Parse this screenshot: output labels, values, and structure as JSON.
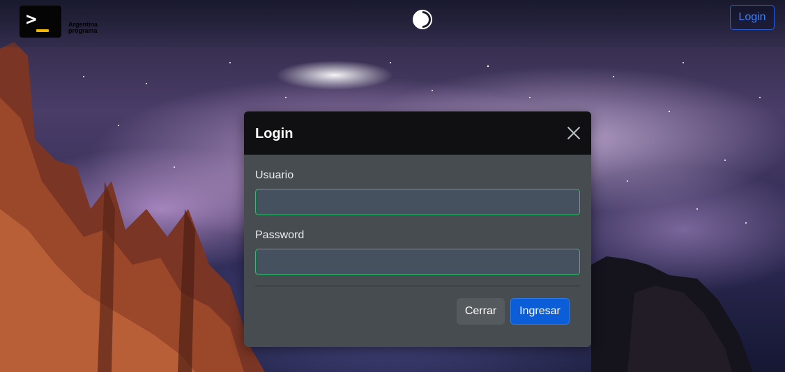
{
  "navbar": {
    "brand_line1": "Argentina",
    "brand_line2": "programa",
    "logo_icon": "terminal-prompt-icon",
    "theme_icon": "contrast-toggle-icon",
    "login_label": "Login"
  },
  "modal": {
    "title": "Login",
    "close_icon": "close-icon",
    "username_label": "Usuario",
    "username_value": "",
    "password_label": "Password",
    "password_value": "",
    "cancel_label": "Cerrar",
    "submit_label": "Ingresar"
  },
  "colors": {
    "primary": "#0b5ed7",
    "valid_border": "#2fbf6a",
    "logo_accent": "#f2b705",
    "header_bg": "#101012",
    "body_bg": "#474c50"
  }
}
